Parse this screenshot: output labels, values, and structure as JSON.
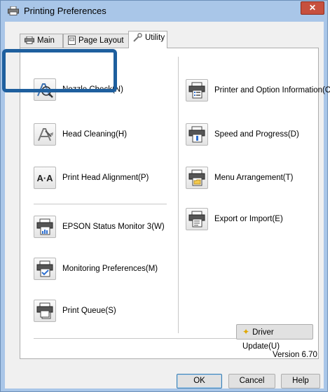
{
  "window": {
    "title": "Printing Preferences",
    "close_symbol": "✕"
  },
  "tabs": [
    {
      "label": "Main",
      "icon": "printer-icon"
    },
    {
      "label": "Page Layout",
      "icon": "page-icon"
    },
    {
      "label": "Utility",
      "icon": "wrench-icon",
      "active": true
    }
  ],
  "utility": {
    "left": [
      {
        "label": "Nozzle Check(N)",
        "icon": "nozzle-check-icon"
      },
      {
        "label": "Head Cleaning(H)",
        "icon": "head-cleaning-icon"
      },
      {
        "label": "Print Head Alignment(P)",
        "icon": "head-alignment-icon",
        "glyph": "A·A"
      },
      {
        "label": "EPSON Status Monitor 3(W)",
        "icon": "status-monitor-icon"
      },
      {
        "label": "Monitoring Preferences(M)",
        "icon": "monitoring-preferences-icon"
      },
      {
        "label": "Print Queue(S)",
        "icon": "print-queue-icon"
      }
    ],
    "right": [
      {
        "label": "Printer and Option Information(O)",
        "icon": "printer-info-icon"
      },
      {
        "label": "Speed and Progress(D)",
        "icon": "speed-progress-icon"
      },
      {
        "label": "Menu Arrangement(T)",
        "icon": "menu-arrangement-icon"
      },
      {
        "label": "Export or Import(E)",
        "icon": "export-import-icon"
      }
    ],
    "driver_update_label": "Driver Update(U)",
    "version_text": "Version 6.70"
  },
  "footer": {
    "ok_label": "OK",
    "cancel_label": "Cancel",
    "help_label": "Help"
  },
  "colors": {
    "highlight": "#1e5f9e",
    "title_bar": "#a9c6e8",
    "close_button": "#c7503e"
  }
}
